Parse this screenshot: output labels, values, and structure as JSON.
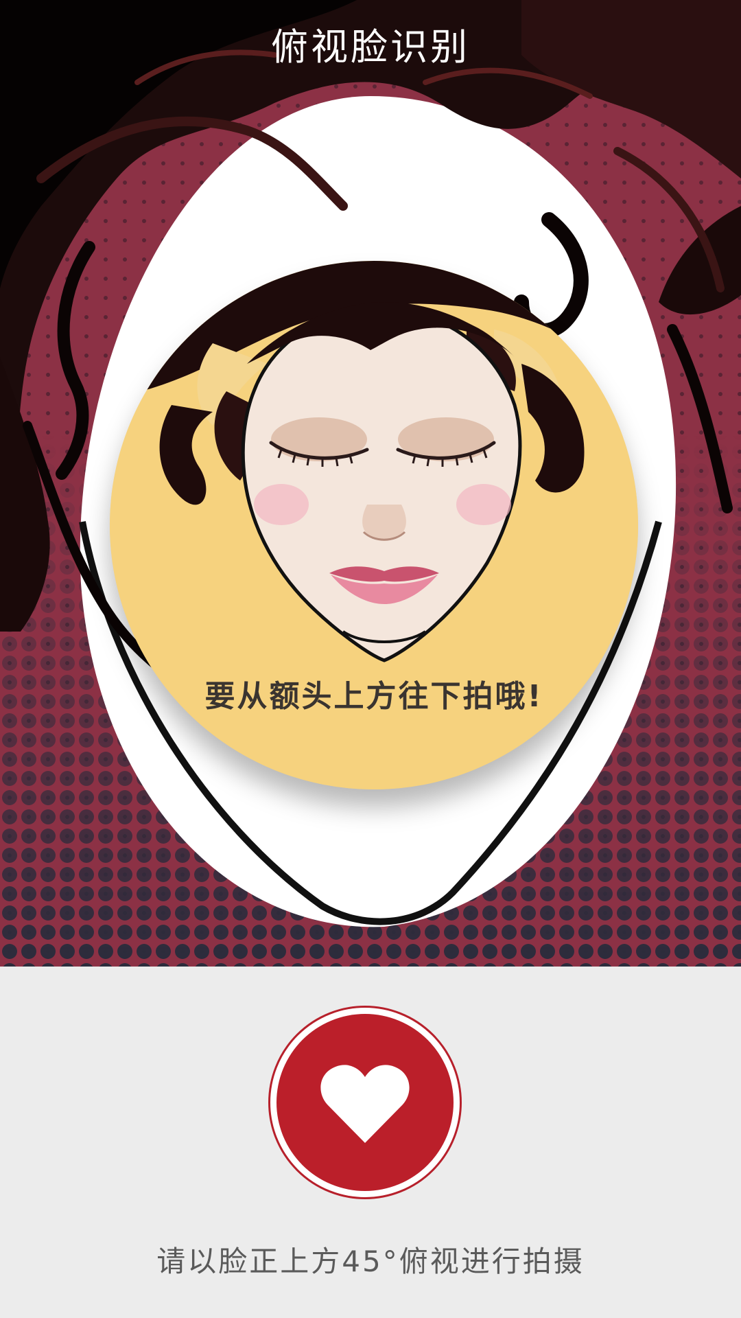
{
  "header": {
    "title": "俯视脸识别"
  },
  "illustration": {
    "instruction": "要从额头上方往下拍哦!",
    "icons": [
      "hair-illustration-icon",
      "face-illustration-icon"
    ]
  },
  "capture": {
    "icon": "heart-icon"
  },
  "footer": {
    "hint": "请以脸正上方45°俯视进行拍摄"
  },
  "colors": {
    "background_magenta": "#8c3145",
    "halftone_dot": "#2b2c3c",
    "face_circle": "#f6d27e",
    "capture_red": "#bb1f2a",
    "panel_gray": "#ececec"
  }
}
